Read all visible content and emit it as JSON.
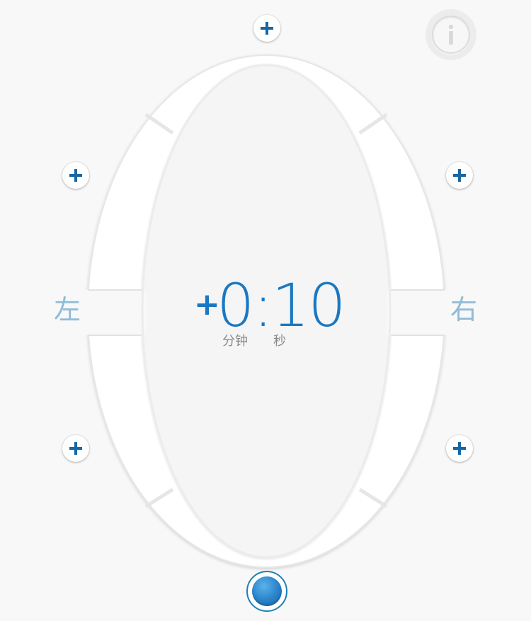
{
  "timer": {
    "sign": "+",
    "value": "0:10",
    "minutes_label": "分钟",
    "seconds_label": "秒"
  },
  "sides": {
    "left_label": "左",
    "right_label": "右"
  },
  "colors": {
    "accent": "#1a78c2",
    "side_label": "#8fbcd8",
    "background": "#f8f8f8"
  },
  "icons": {
    "plus": "plus-icon",
    "info": "info-icon",
    "start": "record-dot-icon"
  }
}
